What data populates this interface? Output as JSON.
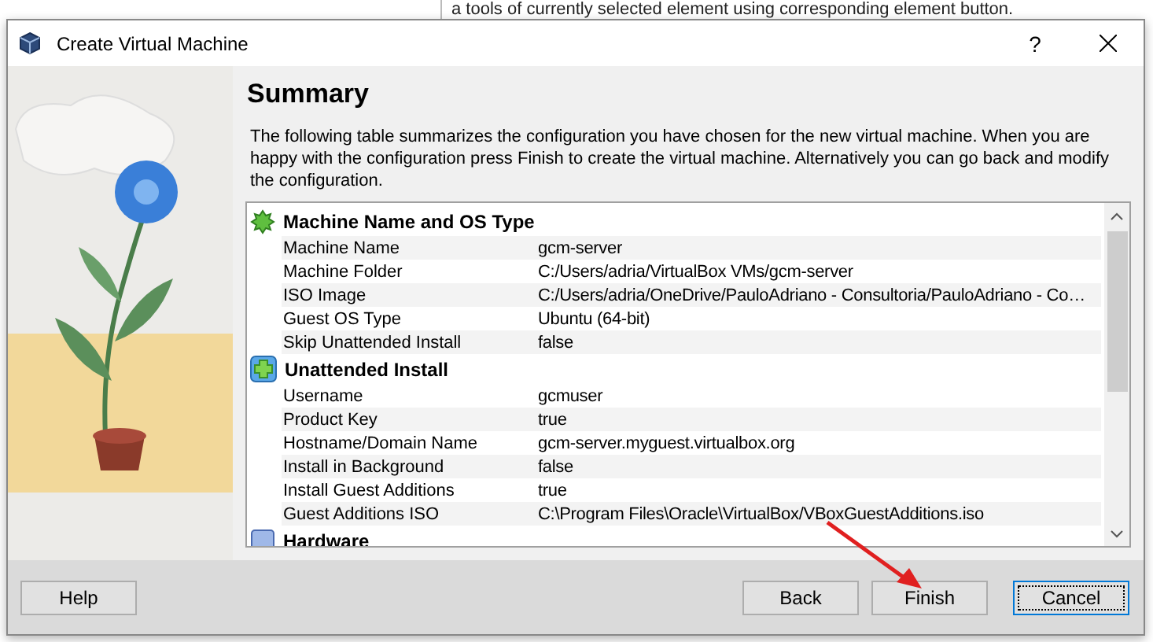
{
  "background_text": "a tools of currently selected element using corresponding element button.",
  "window": {
    "title": "Create Virtual Machine",
    "help_glyph": "?"
  },
  "page": {
    "heading": "Summary",
    "description": "The following table summarizes the configuration you have chosen for the new virtual machine. When you are happy with the configuration press Finish to create the virtual machine. Alternatively you can go back and modify the configuration."
  },
  "sections": [
    {
      "kind": "general",
      "title": "Machine Name and OS Type",
      "rows": [
        {
          "label": "Machine Name",
          "value": "gcm-server"
        },
        {
          "label": "Machine Folder",
          "value": "C:/Users/adria/VirtualBox VMs/gcm-server"
        },
        {
          "label": "ISO Image",
          "value": "C:/Users/adria/OneDrive/PauloAdriano - Consultoria/PauloAdriano - Co…"
        },
        {
          "label": "Guest OS Type",
          "value": "Ubuntu (64-bit)"
        },
        {
          "label": "Skip Unattended Install",
          "value": "false"
        }
      ]
    },
    {
      "kind": "unattended",
      "title": "Unattended Install",
      "rows": [
        {
          "label": "Username",
          "value": "gcmuser"
        },
        {
          "label": "Product Key",
          "value": "true"
        },
        {
          "label": "Hostname/Domain Name",
          "value": "gcm-server.myguest.virtualbox.org"
        },
        {
          "label": "Install in Background",
          "value": "false"
        },
        {
          "label": "Install Guest Additions",
          "value": "true"
        },
        {
          "label": "Guest Additions ISO",
          "value": "C:\\Program Files\\Oracle\\VirtualBox/VBoxGuestAdditions.iso"
        }
      ]
    },
    {
      "kind": "hardware",
      "title": "Hardware"
    }
  ],
  "buttons": [
    {
      "label": "Help",
      "kind": "left",
      "focused": false
    },
    {
      "label": "Back",
      "kind": "right",
      "focused": false
    },
    {
      "label": "Finish",
      "kind": "right",
      "focused": false
    },
    {
      "label": "Cancel",
      "kind": "right",
      "focused": true
    }
  ]
}
